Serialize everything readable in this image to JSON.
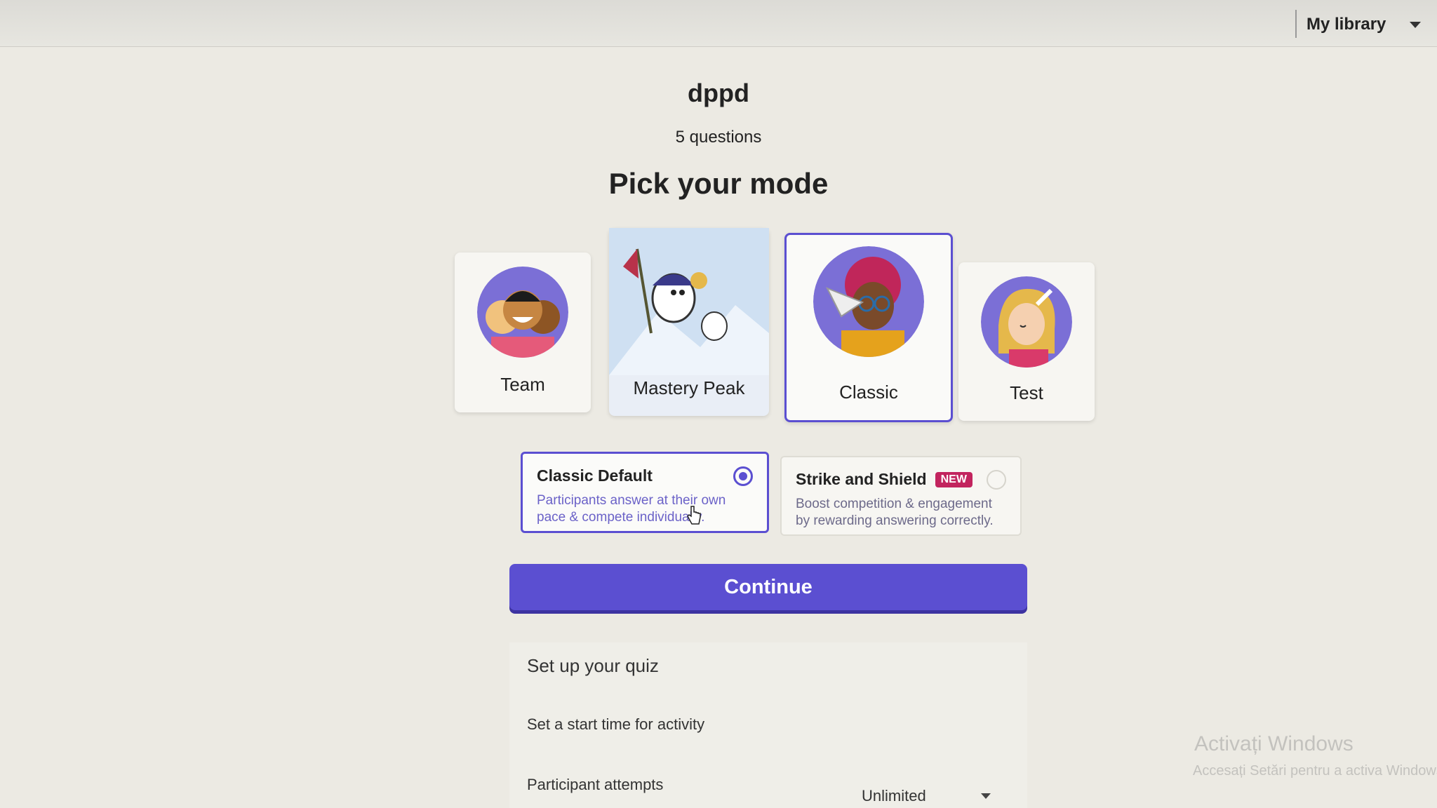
{
  "topbar": {
    "library_label": "My library"
  },
  "quiz": {
    "title": "dppd",
    "question_count": "5 questions"
  },
  "heading": "Pick your mode",
  "modes": [
    {
      "label": "Team"
    },
    {
      "label": "Mastery Peak"
    },
    {
      "label": "Classic",
      "selected": true
    },
    {
      "label": "Test"
    }
  ],
  "classic_options": [
    {
      "title": "Classic Default",
      "description": "Participants answer at their own pace & compete individually.",
      "selected": true
    },
    {
      "title": "Strike and Shield",
      "badge": "NEW",
      "description": "Boost competition & engagement by rewarding answering correctly.",
      "selected": false
    }
  ],
  "continue_label": "Continue",
  "settings": {
    "title": "Set up your quiz",
    "start_time": "Set a start time for activity",
    "attempts_label": "Participant attempts",
    "attempts_value": "Unlimited"
  },
  "watermark": {
    "title": "Activați Windows",
    "subtitle": "Accesați Setări pentru a activa Windows."
  },
  "colors": {
    "accent": "#5b4fd1",
    "badge": "#c2245e"
  }
}
